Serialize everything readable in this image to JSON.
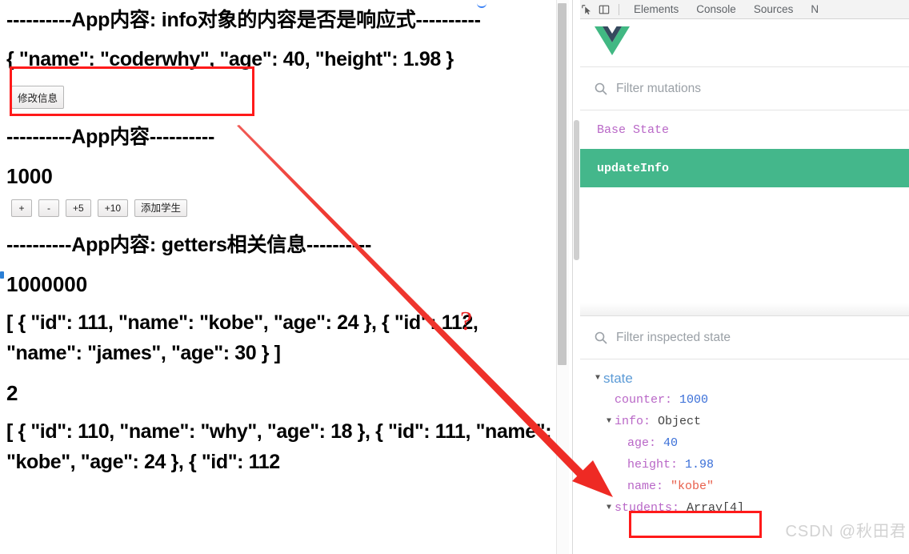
{
  "page": {
    "heading_info": "----------App内容: info对象的内容是否是响应式----------",
    "info_object_line": "{ \"name\": \"coderwhy\", \"age\": 40, \"height\": 1.98 }",
    "modify_button": "修改信息",
    "heading_app": "----------App内容----------",
    "counter_value": "1000",
    "buttons": [
      {
        "name": "increment-button",
        "label": "+"
      },
      {
        "name": "decrement-button",
        "label": "-"
      },
      {
        "name": "add-five-button",
        "label": "+5"
      },
      {
        "name": "add-ten-button",
        "label": "+10"
      },
      {
        "name": "add-student-button",
        "label": "添加学生"
      }
    ],
    "heading_getters": "----------App内容: getters相关信息----------",
    "double_counter": "1000000",
    "students_over_20": "[ { \"id\": 111, \"name\": \"kobe\", \"age\": 24 }, { \"id\": 112, \"name\": \"james\", \"age\": 30 } ]",
    "students_count": "2",
    "students_all": "[ { \"id\": 110, \"name\": \"why\", \"age\": 18 }, { \"id\": 111, \"name\": \"kobe\", \"age\": 24 }, { \"id\": 112"
  },
  "devtools": {
    "tabs": [
      {
        "name": "tab-elements",
        "label": "Elements"
      },
      {
        "name": "tab-console",
        "label": "Console"
      },
      {
        "name": "tab-sources",
        "label": "Sources"
      },
      {
        "name": "tab-network",
        "label": "N"
      }
    ],
    "vue_logo_alt": "vue-logo",
    "mutations_filter_placeholder": "Filter mutations",
    "mutations": [
      {
        "name": "mutation-base-state",
        "label": "Base State",
        "active": false
      },
      {
        "name": "mutation-update-info",
        "label": "updateInfo",
        "active": true
      }
    ],
    "inspected_filter_placeholder": "Filter inspected state",
    "state_root_label": "state",
    "state": {
      "counter_key": "counter:",
      "counter_value": "1000",
      "info_key": "info:",
      "info_type": "Object",
      "age_key": "age:",
      "age_value": "40",
      "height_key": "height:",
      "height_value": "1.98",
      "name_key": "name:",
      "name_value": "\"kobe\"",
      "students_key": "students:",
      "students_type": "Array[4]"
    }
  },
  "annotations": {
    "question_mark": "?",
    "arrow_color": "#ee2a24",
    "highlight_color": "#ff1a1a"
  },
  "watermark": "CSDN @秋田君"
}
